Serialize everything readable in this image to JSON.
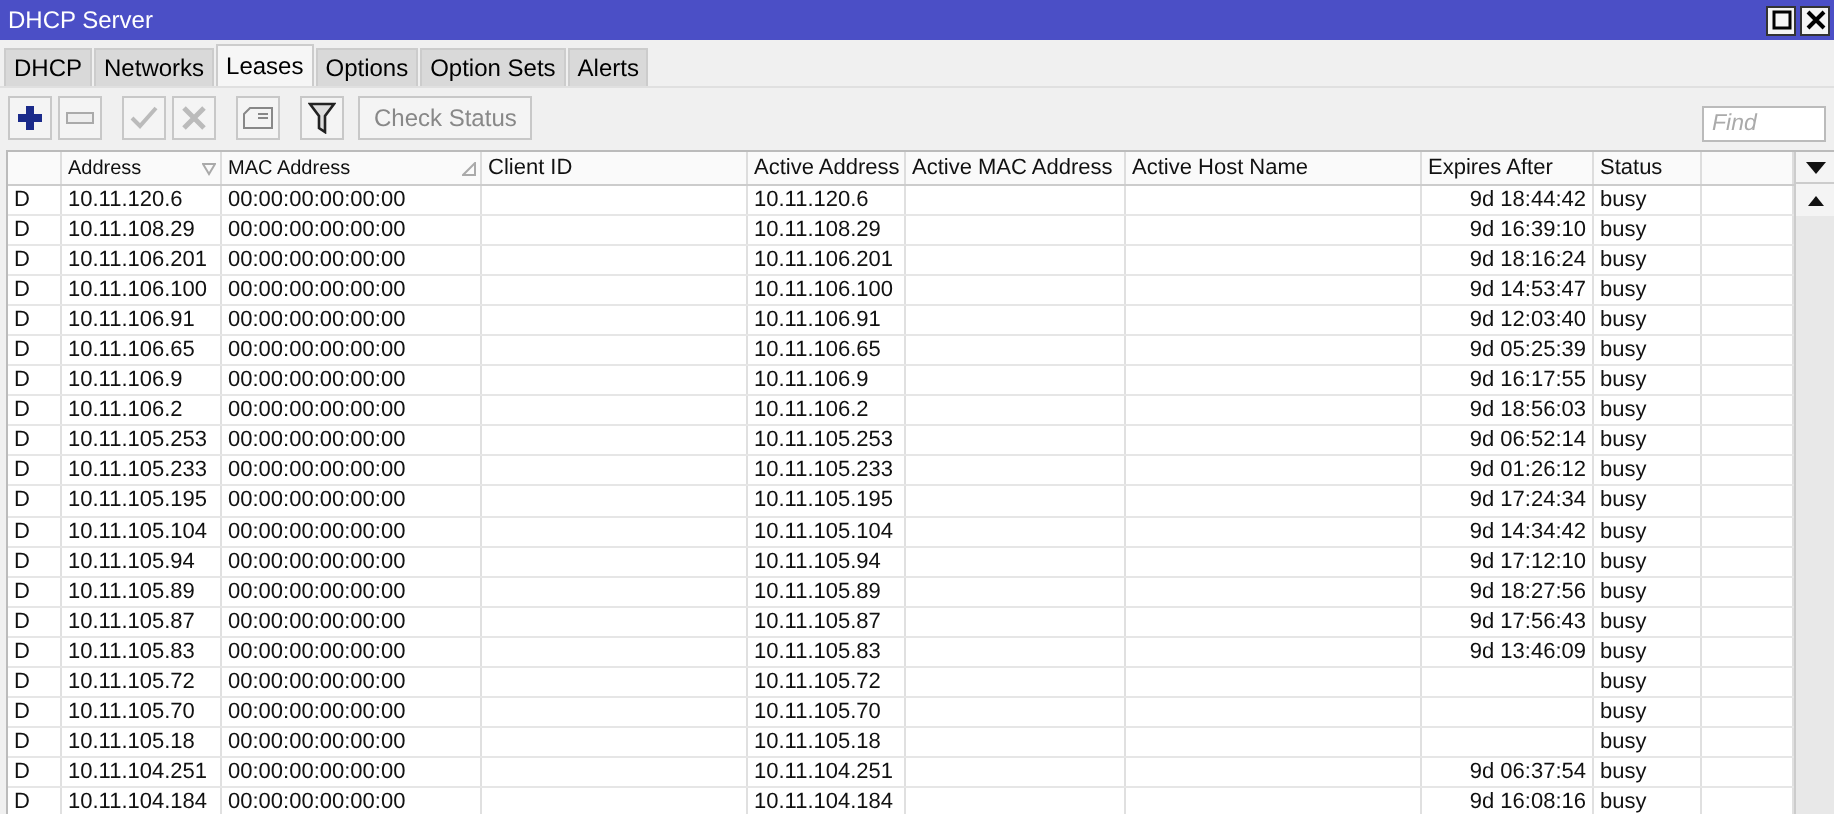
{
  "window": {
    "title": "DHCP Server"
  },
  "tabs": [
    {
      "label": "DHCP",
      "selected": false
    },
    {
      "label": "Networks",
      "selected": false
    },
    {
      "label": "Leases",
      "selected": true
    },
    {
      "label": "Options",
      "selected": false
    },
    {
      "label": "Option Sets",
      "selected": false
    },
    {
      "label": "Alerts",
      "selected": false
    }
  ],
  "toolbar": {
    "check_status": "Check Status",
    "find": {
      "placeholder": "Find"
    }
  },
  "table": {
    "columns": [
      {
        "sorted": false
      },
      {
        "label": "Address",
        "sorted": true
      },
      {
        "label": "MAC Address",
        "sorted": true
      },
      {
        "label": "Client ID",
        "sorted": false
      },
      {
        "label": "Active Address",
        "sorted": false
      },
      {
        "label": "Active MAC Address",
        "sorted": false
      },
      {
        "label": "Active Host Name",
        "sorted": false
      },
      {
        "label": "Expires After",
        "sorted": false
      },
      {
        "label": "Status",
        "sorted": false
      },
      {
        "sorted": false
      }
    ],
    "rows": [
      {
        "flag": "D",
        "address": "10.11.120.6",
        "mac": "00:00:00:00:00:00",
        "active_address": "10.11.120.6",
        "expires": "9d 18:44:42",
        "status": "busy"
      },
      {
        "flag": "D",
        "address": "10.11.108.29",
        "mac": "00:00:00:00:00:00",
        "active_address": "10.11.108.29",
        "expires": "9d 16:39:10",
        "status": "busy"
      },
      {
        "flag": "D",
        "address": "10.11.106.201",
        "mac": "00:00:00:00:00:00",
        "active_address": "10.11.106.201",
        "expires": "9d 18:16:24",
        "status": "busy"
      },
      {
        "flag": "D",
        "address": "10.11.106.100",
        "mac": "00:00:00:00:00:00",
        "active_address": "10.11.106.100",
        "expires": "9d 14:53:47",
        "status": "busy"
      },
      {
        "flag": "D",
        "address": "10.11.106.91",
        "mac": "00:00:00:00:00:00",
        "active_address": "10.11.106.91",
        "expires": "9d 12:03:40",
        "status": "busy"
      },
      {
        "flag": "D",
        "address": "10.11.106.65",
        "mac": "00:00:00:00:00:00",
        "active_address": "10.11.106.65",
        "expires": "9d 05:25:39",
        "status": "busy"
      },
      {
        "flag": "D",
        "address": "10.11.106.9",
        "mac": "00:00:00:00:00:00",
        "active_address": "10.11.106.9",
        "expires": "9d 16:17:55",
        "status": "busy"
      },
      {
        "flag": "D",
        "address": "10.11.106.2",
        "mac": "00:00:00:00:00:00",
        "active_address": "10.11.106.2",
        "expires": "9d 18:56:03",
        "status": "busy"
      },
      {
        "flag": "D",
        "address": "10.11.105.253",
        "mac": "00:00:00:00:00:00",
        "active_address": "10.11.105.253",
        "expires": "9d 06:52:14",
        "status": "busy"
      },
      {
        "flag": "D",
        "address": "10.11.105.233",
        "mac": "00:00:00:00:00:00",
        "active_address": "10.11.105.233",
        "expires": "9d 01:26:12",
        "status": "busy"
      },
      {
        "flag": "D",
        "address": "10.11.105.195",
        "mac": "00:00:00:00:00:00",
        "active_address": "10.11.105.195",
        "expires": "9d 17:24:34",
        "status": "busy"
      },
      {
        "flag": "D",
        "address": "10.11.105.104",
        "mac": "00:00:00:00:00:00",
        "active_address": "10.11.105.104",
        "expires": "9d 14:34:42",
        "status": "busy"
      },
      {
        "flag": "D",
        "address": "10.11.105.94",
        "mac": "00:00:00:00:00:00",
        "active_address": "10.11.105.94",
        "expires": "9d 17:12:10",
        "status": "busy"
      },
      {
        "flag": "D",
        "address": "10.11.105.89",
        "mac": "00:00:00:00:00:00",
        "active_address": "10.11.105.89",
        "expires": "9d 18:27:56",
        "status": "busy"
      },
      {
        "flag": "D",
        "address": "10.11.105.87",
        "mac": "00:00:00:00:00:00",
        "active_address": "10.11.105.87",
        "expires": "9d 17:56:43",
        "status": "busy"
      },
      {
        "flag": "D",
        "address": "10.11.105.83",
        "mac": "00:00:00:00:00:00",
        "active_address": "10.11.105.83",
        "expires": "9d 13:46:09",
        "status": "busy"
      },
      {
        "flag": "D",
        "address": "10.11.105.72",
        "mac": "00:00:00:00:00:00",
        "active_address": "10.11.105.72",
        "status": "busy"
      },
      {
        "flag": "D",
        "address": "10.11.105.70",
        "mac": "00:00:00:00:00:00",
        "active_address": "10.11.105.70",
        "status": "busy"
      },
      {
        "flag": "D",
        "address": "10.11.105.18",
        "mac": "00:00:00:00:00:00",
        "active_address": "10.11.105.18",
        "status": "busy"
      },
      {
        "flag": "D",
        "address": "10.11.104.251",
        "mac": "00:00:00:00:00:00",
        "active_address": "10.11.104.251",
        "expires": "9d 06:37:54",
        "status": "busy"
      },
      {
        "flag": "D",
        "address": "10.11.104.184",
        "mac": "00:00:00:00:00:00",
        "active_address": "10.11.104.184",
        "expires": "9d 16:08:16",
        "status": "busy"
      }
    ]
  }
}
